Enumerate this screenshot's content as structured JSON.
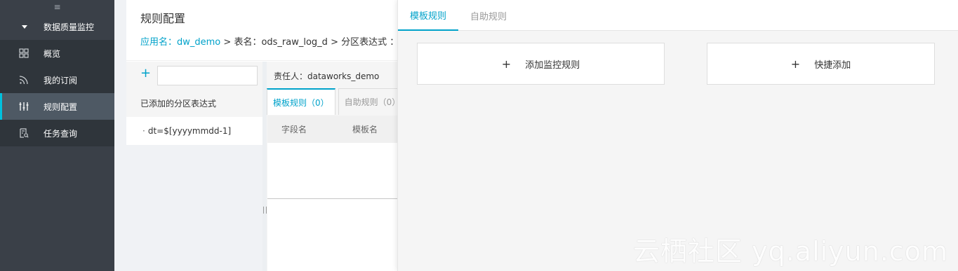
{
  "sidebar": {
    "collapse_glyph": "≡",
    "group": "数据质量监控",
    "items": [
      {
        "label": "概览",
        "icon": "grid-icon"
      },
      {
        "label": "我的订阅",
        "icon": "rss-icon"
      },
      {
        "label": "规则配置",
        "icon": "sliders-icon",
        "active": true
      },
      {
        "label": "任务查询",
        "icon": "list-search-icon"
      }
    ]
  },
  "header": {
    "title": "规则配置",
    "breadcrumb": {
      "app": "应用名：dw_demo",
      "sep1": " > ",
      "table": "表名：ods_raw_log_d",
      "sep2": " > ",
      "partition": "分区表达式 ："
    }
  },
  "left": {
    "search_value": "",
    "added_label": "已添加的分区表达式",
    "partition_item": "dt=$[yyyymmdd-1]"
  },
  "center": {
    "owner": "责任人：dataworks_demo",
    "tabs": [
      "模板规则（0）",
      "自助规则（0）"
    ],
    "columns": [
      "字段名",
      "模板名"
    ]
  },
  "drawer": {
    "tabs": [
      "模板规则",
      "自助规则"
    ],
    "add_rule": "添加监控规则",
    "quick_add": "快捷添加"
  },
  "watermark": "云栖社区 yq.aliyun.com",
  "colors": {
    "accent": "#00a2ca",
    "sidebar_bg": "#3a4048"
  }
}
